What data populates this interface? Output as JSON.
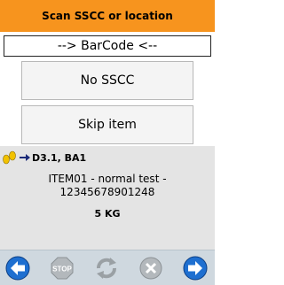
{
  "title": "Scan SSCC or location",
  "barcode_field": {
    "value": "--> BarCode <--"
  },
  "buttons": {
    "no_sscc": "No SSCC",
    "skip_item": "Skip item"
  },
  "info": {
    "location": "D3.1, BA1",
    "item_line1": "ITEM01 - normal test -",
    "item_line2": "12345678901248",
    "quantity": "5 KG"
  },
  "toolbar": {
    "stop_label": "STOP",
    "icons": [
      "back-arrow-icon",
      "stop-icon",
      "refresh-icon",
      "cancel-icon",
      "next-arrow-icon"
    ],
    "active_color": "#1e6fd0",
    "disabled_color": "#9aa0a4"
  },
  "colors": {
    "title_bar": "#f7941e",
    "panel": "#e4e4e4",
    "toolbar": "#cfd8df"
  }
}
